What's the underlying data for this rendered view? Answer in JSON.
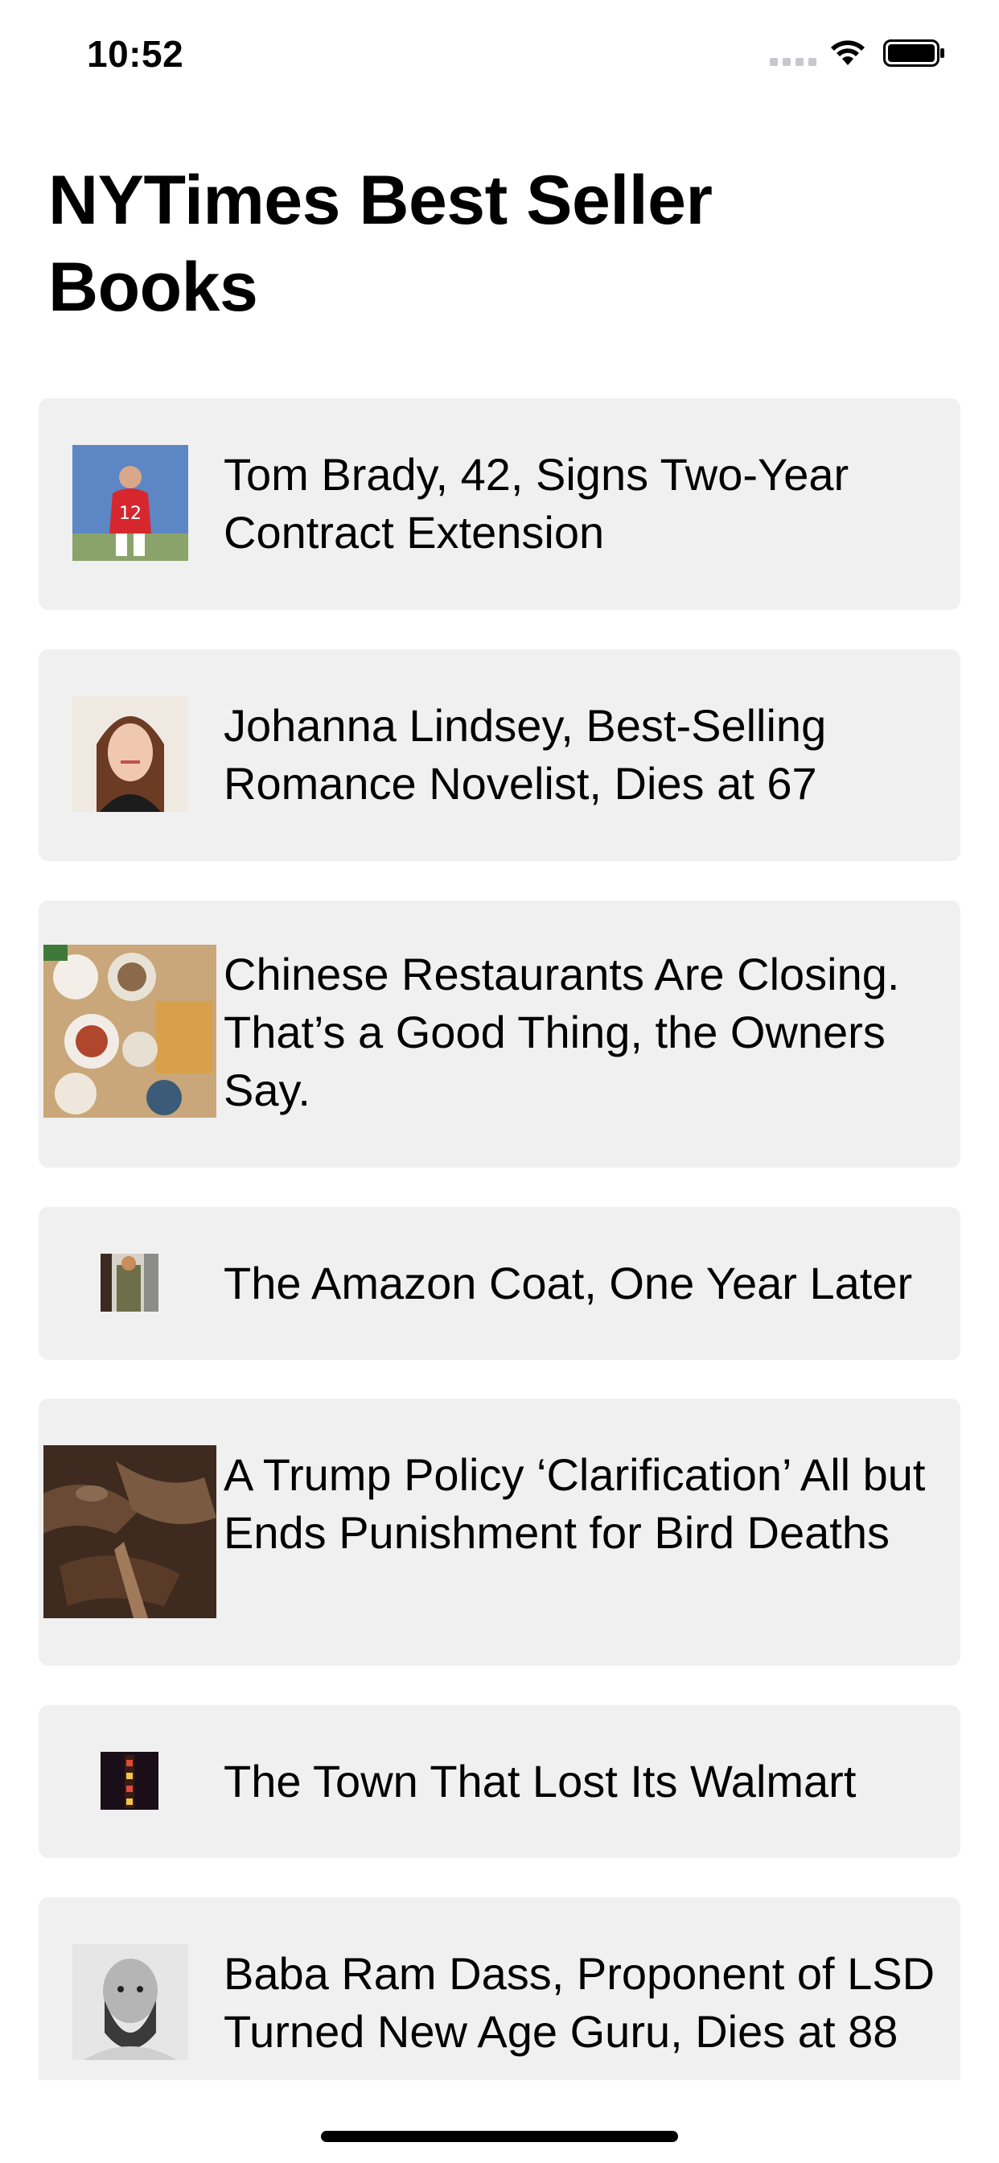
{
  "status_bar": {
    "time": "10:52"
  },
  "header": {
    "title": "NYTimes Best Seller Books"
  },
  "articles": [
    {
      "headline": "Tom Brady, 42, Signs Two-Year Contract Extension",
      "image": "football-player-photo"
    },
    {
      "headline": "Johanna Lindsey, Best-Selling Romance Novelist, Dies at 67",
      "image": "portrait-woman-photo"
    },
    {
      "headline": "Chinese Restaurants Are Closing. That’s a Good Thing, the Owners Say.",
      "image": "food-table-photo"
    },
    {
      "headline": "The Amazon Coat, One Year Later",
      "image": "coat-photo"
    },
    {
      "headline": "A Trump Policy ‘Clarification’ All but Ends Punishment for Bird Deaths",
      "image": "birds-photo"
    },
    {
      "headline": "The Town That Lost Its Walmart",
      "image": "neon-sign-photo"
    },
    {
      "headline": "Baba Ram Dass, Proponent of LSD Turned New Age Guru, Dies at 88",
      "image": "portrait-man-photo"
    }
  ],
  "colors": {
    "card_background": "#f0f0f0",
    "page_background": "#ffffff",
    "text": "#000000"
  }
}
